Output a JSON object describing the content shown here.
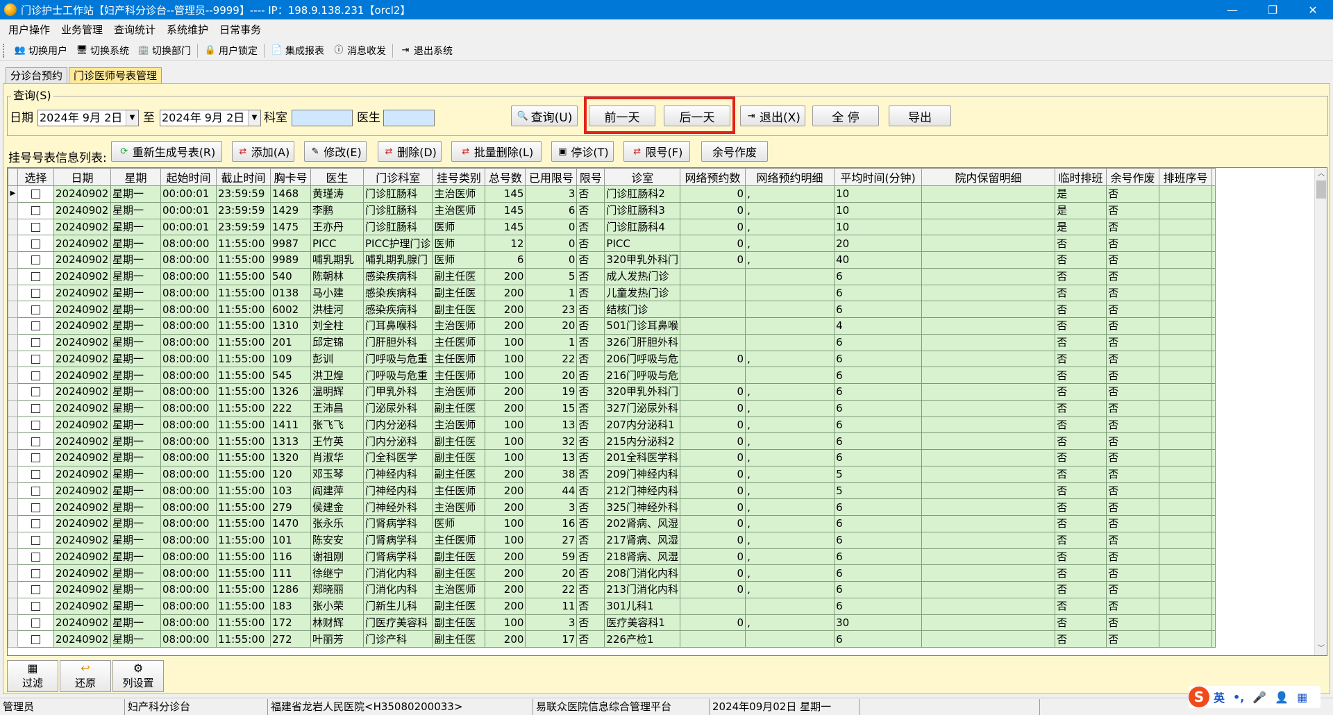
{
  "window": {
    "title": "门诊护士工作站【妇产科分诊台--管理员--9999】---- IP：198.9.138.231【orcl2】",
    "minimize": "—",
    "restore": "❐",
    "close": "✕"
  },
  "menu": [
    "用户操作",
    "业务管理",
    "查询统计",
    "系统维护",
    "日常事务"
  ],
  "toolbar": [
    {
      "label": "切换用户",
      "icon": "switch-user-icon",
      "glyph": "👥"
    },
    {
      "label": "切换系统",
      "icon": "switch-system-icon",
      "glyph": "🖥"
    },
    {
      "label": "切换部门",
      "icon": "switch-dept-icon",
      "glyph": "🏢"
    },
    {
      "label": "用户锁定",
      "icon": "user-lock-icon",
      "glyph": "🔒"
    },
    {
      "label": "集成报表",
      "icon": "report-icon",
      "glyph": "📄"
    },
    {
      "label": "消息收发",
      "icon": "info-icon",
      "glyph": "ⓘ"
    },
    {
      "label": "退出系统",
      "icon": "exit-icon",
      "glyph": "⇥"
    }
  ],
  "tabs": [
    {
      "label": "分诊台预约",
      "active": false
    },
    {
      "label": "门诊医师号表管理",
      "active": true
    }
  ],
  "query": {
    "legend": "查询(S)",
    "date_label": "日期",
    "date_from": "2024年 9月 2日",
    "to_label": "至",
    "date_to": "2024年 9月 2日",
    "dept_label": "科室",
    "doctor_label": "医生",
    "dept_value": "",
    "doctor_value": "",
    "search_btn": "查询(U)",
    "prev_day": "前一天",
    "next_day": "后一天",
    "exit_btn": "退出(X)",
    "stop_all": "全 停",
    "export_btn": "导出"
  },
  "list": {
    "label": "挂号号表信息列表:",
    "actions": {
      "regen": "重新生成号表(R)",
      "add": "添加(A)",
      "edit": "修改(E)",
      "delete": "删除(D)",
      "batch_delete": "批量删除(L)",
      "stop": "停诊(T)",
      "limit": "限号(F)",
      "void": "余号作废"
    }
  },
  "columns": [
    "选择",
    "日期",
    "星期",
    "起始时间",
    "截止时间",
    "胸卡号",
    "医生",
    "门诊科室",
    "挂号类别",
    "总号数",
    "已用限号",
    "限号",
    "诊室",
    "网络预约数",
    "网络预约明细",
    "平均时间(分钟)",
    "院内保留明细",
    "临时排班",
    "余号作废",
    "排班序号"
  ],
  "rows": [
    [
      "20240902",
      "星期一",
      "00:00:01",
      "23:59:59",
      "1468",
      "黄瑾涛",
      "门诊肛肠科",
      "主治医师",
      "145",
      "3",
      "否",
      "门诊肛肠科2",
      "0",
      ",",
      "10",
      "",
      "是",
      "否",
      ""
    ],
    [
      "20240902",
      "星期一",
      "00:00:01",
      "23:59:59",
      "1429",
      "李鹏",
      "门诊肛肠科",
      "主治医师",
      "145",
      "6",
      "否",
      "门诊肛肠科3",
      "0",
      ",",
      "10",
      "",
      "是",
      "否",
      ""
    ],
    [
      "20240902",
      "星期一",
      "00:00:01",
      "23:59:59",
      "1475",
      "王亦丹",
      "门诊肛肠科",
      "医师",
      "145",
      "0",
      "否",
      "门诊肛肠科4",
      "0",
      ",",
      "10",
      "",
      "是",
      "否",
      ""
    ],
    [
      "20240902",
      "星期一",
      "08:00:00",
      "11:55:00",
      "9987",
      "PICC",
      "PICC护理门诊",
      "医师",
      "12",
      "0",
      "否",
      "PICC",
      "0",
      ",",
      "20",
      "",
      "否",
      "否",
      ""
    ],
    [
      "20240902",
      "星期一",
      "08:00:00",
      "11:55:00",
      "9989",
      "哺乳期乳",
      "哺乳期乳腺门",
      "医师",
      "6",
      "0",
      "否",
      "320甲乳外科门",
      "0",
      ",",
      "40",
      "",
      "否",
      "否",
      ""
    ],
    [
      "20240902",
      "星期一",
      "08:00:00",
      "11:55:00",
      "540",
      "陈朝林",
      "感染疾病科",
      "副主任医",
      "200",
      "5",
      "否",
      "成人发热门诊",
      "",
      "",
      "6",
      "",
      "否",
      "否",
      ""
    ],
    [
      "20240902",
      "星期一",
      "08:00:00",
      "11:55:00",
      "0138",
      "马小建",
      "感染疾病科",
      "副主任医",
      "200",
      "1",
      "否",
      "儿童发热门诊",
      "",
      "",
      "6",
      "",
      "否",
      "否",
      ""
    ],
    [
      "20240902",
      "星期一",
      "08:00:00",
      "11:55:00",
      "6002",
      "洪桂河",
      "感染疾病科",
      "副主任医",
      "200",
      "23",
      "否",
      "结核门诊",
      "",
      "",
      "6",
      "",
      "否",
      "否",
      ""
    ],
    [
      "20240902",
      "星期一",
      "08:00:00",
      "11:55:00",
      "1310",
      "刘全柱",
      "门耳鼻喉科",
      "主治医师",
      "200",
      "20",
      "否",
      "501门诊耳鼻喉",
      "",
      "",
      "4",
      "",
      "否",
      "否",
      ""
    ],
    [
      "20240902",
      "星期一",
      "08:00:00",
      "11:55:00",
      "201",
      "邱定锦",
      "门肝胆外科",
      "主任医师",
      "100",
      "1",
      "否",
      "326门肝胆外科",
      "",
      "",
      "6",
      "",
      "否",
      "否",
      ""
    ],
    [
      "20240902",
      "星期一",
      "08:00:00",
      "11:55:00",
      "109",
      "彭训",
      "门呼吸与危重",
      "主任医师",
      "100",
      "22",
      "否",
      "206门呼吸与危",
      "0",
      ",",
      "6",
      "",
      "否",
      "否",
      ""
    ],
    [
      "20240902",
      "星期一",
      "08:00:00",
      "11:55:00",
      "545",
      "洪卫煌",
      "门呼吸与危重",
      "主任医师",
      "100",
      "20",
      "否",
      "216门呼吸与危",
      "",
      "",
      "6",
      "",
      "否",
      "否",
      ""
    ],
    [
      "20240902",
      "星期一",
      "08:00:00",
      "11:55:00",
      "1326",
      "温明辉",
      "门甲乳外科",
      "主治医师",
      "200",
      "19",
      "否",
      "320甲乳外科门",
      "0",
      ",",
      "6",
      "",
      "否",
      "否",
      ""
    ],
    [
      "20240902",
      "星期一",
      "08:00:00",
      "11:55:00",
      "222",
      "王沛昌",
      "门泌尿外科",
      "副主任医",
      "200",
      "15",
      "否",
      "327门泌尿外科",
      "0",
      ",",
      "6",
      "",
      "否",
      "否",
      ""
    ],
    [
      "20240902",
      "星期一",
      "08:00:00",
      "11:55:00",
      "1411",
      "张飞飞",
      "门内分泌科",
      "主治医师",
      "100",
      "13",
      "否",
      "207内分泌科1",
      "0",
      ",",
      "6",
      "",
      "否",
      "否",
      ""
    ],
    [
      "20240902",
      "星期一",
      "08:00:00",
      "11:55:00",
      "1313",
      "王竹英",
      "门内分泌科",
      "副主任医",
      "100",
      "32",
      "否",
      "215内分泌科2",
      "0",
      ",",
      "6",
      "",
      "否",
      "否",
      ""
    ],
    [
      "20240902",
      "星期一",
      "08:00:00",
      "11:55:00",
      "1320",
      "肖淑华",
      "门全科医学",
      "副主任医",
      "100",
      "13",
      "否",
      "201全科医学科",
      "0",
      ",",
      "6",
      "",
      "否",
      "否",
      ""
    ],
    [
      "20240902",
      "星期一",
      "08:00:00",
      "11:55:00",
      "120",
      "邓玉琴",
      "门神经内科",
      "副主任医",
      "200",
      "38",
      "否",
      "209门神经内科",
      "0",
      ",",
      "5",
      "",
      "否",
      "否",
      ""
    ],
    [
      "20240902",
      "星期一",
      "08:00:00",
      "11:55:00",
      "103",
      "阎建萍",
      "门神经内科",
      "主任医师",
      "200",
      "44",
      "否",
      "212门神经内科",
      "0",
      ",",
      "5",
      "",
      "否",
      "否",
      ""
    ],
    [
      "20240902",
      "星期一",
      "08:00:00",
      "11:55:00",
      "279",
      "侯建金",
      "门神经外科",
      "主治医师",
      "200",
      "3",
      "否",
      "325门神经外科",
      "0",
      ",",
      "6",
      "",
      "否",
      "否",
      ""
    ],
    [
      "20240902",
      "星期一",
      "08:00:00",
      "11:55:00",
      "1470",
      "张永乐",
      "门肾病学科",
      "医师",
      "100",
      "16",
      "否",
      "202肾病、风湿",
      "0",
      ",",
      "6",
      "",
      "否",
      "否",
      ""
    ],
    [
      "20240902",
      "星期一",
      "08:00:00",
      "11:55:00",
      "101",
      "陈安安",
      "门肾病学科",
      "主任医师",
      "100",
      "27",
      "否",
      "217肾病、风湿",
      "0",
      ",",
      "6",
      "",
      "否",
      "否",
      ""
    ],
    [
      "20240902",
      "星期一",
      "08:00:00",
      "11:55:00",
      "116",
      "谢祖刚",
      "门肾病学科",
      "副主任医",
      "200",
      "59",
      "否",
      "218肾病、风湿",
      "0",
      ",",
      "6",
      "",
      "否",
      "否",
      ""
    ],
    [
      "20240902",
      "星期一",
      "08:00:00",
      "11:55:00",
      "111",
      "徐继宁",
      "门消化内科",
      "副主任医",
      "200",
      "20",
      "否",
      "208门消化内科",
      "0",
      ",",
      "6",
      "",
      "否",
      "否",
      ""
    ],
    [
      "20240902",
      "星期一",
      "08:00:00",
      "11:55:00",
      "1286",
      "郑晓丽",
      "门消化内科",
      "主治医师",
      "200",
      "22",
      "否",
      "213门消化内科",
      "0",
      ",",
      "6",
      "",
      "否",
      "否",
      ""
    ],
    [
      "20240902",
      "星期一",
      "08:00:00",
      "11:55:00",
      "183",
      "张小荣",
      "门新生儿科",
      "副主任医",
      "200",
      "11",
      "否",
      "301儿科1",
      "",
      "",
      "6",
      "",
      "否",
      "否",
      ""
    ],
    [
      "20240902",
      "星期一",
      "08:00:00",
      "11:55:00",
      "172",
      "林财辉",
      "门医疗美容科",
      "副主任医",
      "100",
      "3",
      "否",
      "医疗美容科1",
      "0",
      ",",
      "30",
      "",
      "否",
      "否",
      ""
    ],
    [
      "20240902",
      "星期一",
      "08:00:00",
      "11:55:00",
      "272",
      "叶丽芳",
      "门诊产科",
      "副主任医",
      "200",
      "17",
      "否",
      "226产检1",
      "",
      "",
      "6",
      "",
      "否",
      "否",
      ""
    ]
  ],
  "bottom_tools": [
    {
      "label": "过滤",
      "icon": "filter-icon",
      "glyph": "▦"
    },
    {
      "label": "还原",
      "icon": "restore-icon",
      "glyph": "↩"
    },
    {
      "label": "列设置",
      "icon": "column-settings-icon",
      "glyph": "⚙"
    }
  ],
  "status": [
    "管理员",
    "妇产科分诊台",
    "福建省龙岩人民医院<H35080200033>",
    "易联众医院信息综合管理平台",
    "2024年09月02日 星期一",
    ""
  ],
  "ime": {
    "logo": "S",
    "mode": "英",
    "punct": "•,",
    "mic": "🎤",
    "user": "👤",
    "grid": "▦"
  }
}
